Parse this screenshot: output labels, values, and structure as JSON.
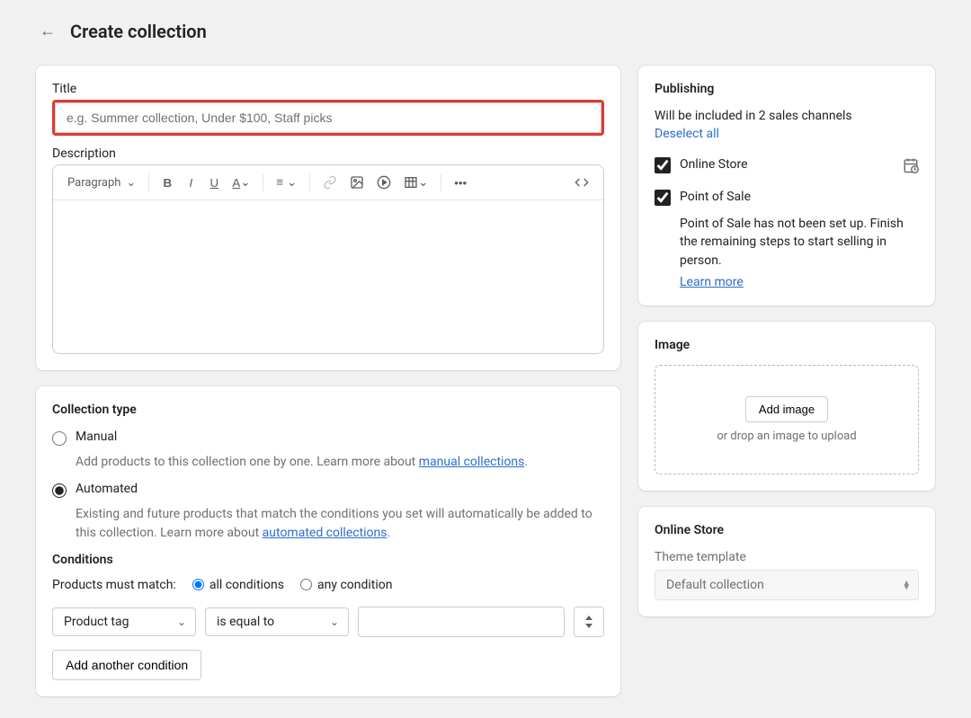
{
  "page": {
    "title": "Create collection"
  },
  "title_field": {
    "label": "Title",
    "placeholder": "e.g. Summer collection, Under $100, Staff picks",
    "value": ""
  },
  "description": {
    "label": "Description",
    "format_selector": "Paragraph"
  },
  "collection_type": {
    "heading": "Collection type",
    "manual": {
      "label": "Manual",
      "desc_prefix": "Add products to this collection one by one. Learn more about ",
      "link": "manual collections",
      "suffix": "."
    },
    "automated": {
      "label": "Automated",
      "desc_prefix": "Existing and future products that match the conditions you set will automatically be added to this collection. Learn more about ",
      "link": "automated collections",
      "suffix": "."
    },
    "selected": "automated"
  },
  "conditions": {
    "heading": "Conditions",
    "match_label": "Products must match:",
    "all_label": "all conditions",
    "any_label": "any condition",
    "match_selected": "all",
    "rows": [
      {
        "field": "Product tag",
        "operator": "is equal to",
        "value": ""
      }
    ],
    "add_label": "Add another condition"
  },
  "publishing": {
    "heading": "Publishing",
    "subtitle": "Will be included in 2 sales channels",
    "deselect": "Deselect all",
    "channels": [
      {
        "name": "Online Store",
        "checked": true,
        "schedule_icon": true
      },
      {
        "name": "Point of Sale",
        "checked": true,
        "note": "Point of Sale has not been set up. Finish the remaining steps to start selling in person.",
        "learn_more": "Learn more"
      }
    ]
  },
  "image": {
    "heading": "Image",
    "button": "Add image",
    "drop_text": "or drop an image to upload"
  },
  "online_store": {
    "heading": "Online Store",
    "template_label": "Theme template",
    "template_value": "Default collection"
  }
}
